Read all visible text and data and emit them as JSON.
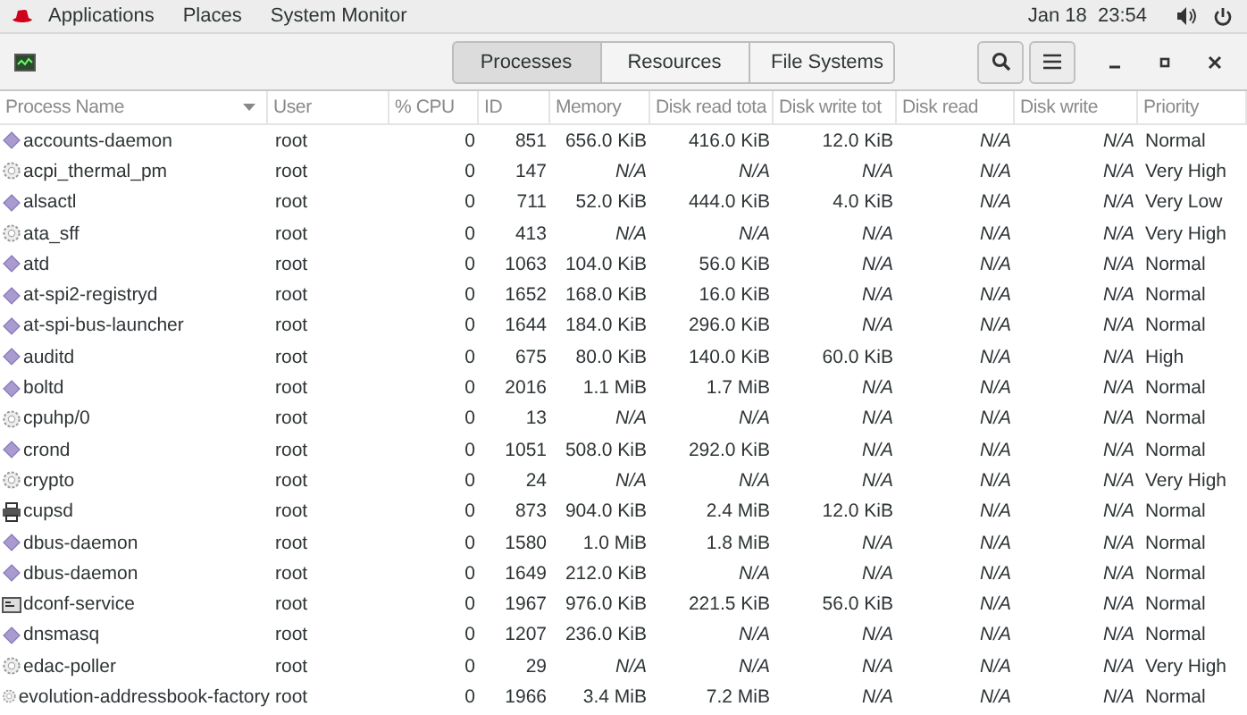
{
  "top_bar": {
    "menus": [
      "Applications",
      "Places",
      "System Monitor"
    ],
    "clock": "Jan 18  23:54"
  },
  "tabs": [
    {
      "label": "Processes",
      "selected": true
    },
    {
      "label": "Resources",
      "selected": false
    },
    {
      "label": "File Systems",
      "selected": false
    }
  ],
  "columns": [
    {
      "label": "Process Name",
      "sorted": true
    },
    {
      "label": "User",
      "sorted": false
    },
    {
      "label": "% CPU",
      "sorted": false
    },
    {
      "label": "ID",
      "sorted": false
    },
    {
      "label": "Memory",
      "sorted": false
    },
    {
      "label": "Disk read tota",
      "sorted": false
    },
    {
      "label": "Disk write tot",
      "sorted": false
    },
    {
      "label": "Disk read",
      "sorted": false
    },
    {
      "label": "Disk write",
      "sorted": false
    },
    {
      "label": "Priority",
      "sorted": false
    }
  ],
  "rows": [
    {
      "kind": "diamond",
      "cells": [
        "accounts-daemon",
        "root",
        "0",
        "851",
        "656.0 KiB",
        "416.0 KiB",
        "12.0 KiB",
        "N/A",
        "N/A",
        "Normal"
      ],
      "italic": [
        false,
        false,
        false,
        false,
        false,
        false,
        false,
        true,
        true,
        false
      ]
    },
    {
      "kind": "gear",
      "cells": [
        "acpi_thermal_pm",
        "root",
        "0",
        "147",
        "N/A",
        "N/A",
        "N/A",
        "N/A",
        "N/A",
        "Very High"
      ],
      "italic": [
        false,
        false,
        false,
        false,
        true,
        true,
        true,
        true,
        true,
        false
      ]
    },
    {
      "kind": "diamond",
      "cells": [
        "alsactl",
        "root",
        "0",
        "711",
        "52.0 KiB",
        "444.0 KiB",
        "4.0 KiB",
        "N/A",
        "N/A",
        "Very Low"
      ],
      "italic": [
        false,
        false,
        false,
        false,
        false,
        false,
        false,
        true,
        true,
        false
      ]
    },
    {
      "kind": "gear",
      "cells": [
        "ata_sff",
        "root",
        "0",
        "413",
        "N/A",
        "N/A",
        "N/A",
        "N/A",
        "N/A",
        "Very High"
      ],
      "italic": [
        false,
        false,
        false,
        false,
        true,
        true,
        true,
        true,
        true,
        false
      ]
    },
    {
      "kind": "diamond",
      "cells": [
        "atd",
        "root",
        "0",
        "1063",
        "104.0 KiB",
        "56.0 KiB",
        "N/A",
        "N/A",
        "N/A",
        "Normal"
      ],
      "italic": [
        false,
        false,
        false,
        false,
        false,
        false,
        true,
        true,
        true,
        false
      ]
    },
    {
      "kind": "diamond",
      "cells": [
        "at-spi2-registryd",
        "root",
        "0",
        "1652",
        "168.0 KiB",
        "16.0 KiB",
        "N/A",
        "N/A",
        "N/A",
        "Normal"
      ],
      "italic": [
        false,
        false,
        false,
        false,
        false,
        false,
        true,
        true,
        true,
        false
      ]
    },
    {
      "kind": "diamond",
      "cells": [
        "at-spi-bus-launcher",
        "root",
        "0",
        "1644",
        "184.0 KiB",
        "296.0 KiB",
        "N/A",
        "N/A",
        "N/A",
        "Normal"
      ],
      "italic": [
        false,
        false,
        false,
        false,
        false,
        false,
        true,
        true,
        true,
        false
      ]
    },
    {
      "kind": "diamond",
      "cells": [
        "auditd",
        "root",
        "0",
        "675",
        "80.0 KiB",
        "140.0 KiB",
        "60.0 KiB",
        "N/A",
        "N/A",
        "High"
      ],
      "italic": [
        false,
        false,
        false,
        false,
        false,
        false,
        false,
        true,
        true,
        false
      ]
    },
    {
      "kind": "diamond",
      "cells": [
        "boltd",
        "root",
        "0",
        "2016",
        "1.1 MiB",
        "1.7 MiB",
        "N/A",
        "N/A",
        "N/A",
        "Normal"
      ],
      "italic": [
        false,
        false,
        false,
        false,
        false,
        false,
        true,
        true,
        true,
        false
      ]
    },
    {
      "kind": "gear",
      "cells": [
        "cpuhp/0",
        "root",
        "0",
        "13",
        "N/A",
        "N/A",
        "N/A",
        "N/A",
        "N/A",
        "Normal"
      ],
      "italic": [
        false,
        false,
        false,
        false,
        true,
        true,
        true,
        true,
        true,
        false
      ]
    },
    {
      "kind": "diamond",
      "cells": [
        "crond",
        "root",
        "0",
        "1051",
        "508.0 KiB",
        "292.0 KiB",
        "N/A",
        "N/A",
        "N/A",
        "Normal"
      ],
      "italic": [
        false,
        false,
        false,
        false,
        false,
        false,
        true,
        true,
        true,
        false
      ]
    },
    {
      "kind": "gear",
      "cells": [
        "crypto",
        "root",
        "0",
        "24",
        "N/A",
        "N/A",
        "N/A",
        "N/A",
        "N/A",
        "Very High"
      ],
      "italic": [
        false,
        false,
        false,
        false,
        true,
        true,
        true,
        true,
        true,
        false
      ]
    },
    {
      "kind": "printer",
      "cells": [
        "cupsd",
        "root",
        "0",
        "873",
        "904.0 KiB",
        "2.4 MiB",
        "12.0 KiB",
        "N/A",
        "N/A",
        "Normal"
      ],
      "italic": [
        false,
        false,
        false,
        false,
        false,
        false,
        false,
        true,
        true,
        false
      ]
    },
    {
      "kind": "diamond",
      "cells": [
        "dbus-daemon",
        "root",
        "0",
        "1580",
        "1.0 MiB",
        "1.8 MiB",
        "N/A",
        "N/A",
        "N/A",
        "Normal"
      ],
      "italic": [
        false,
        false,
        false,
        false,
        false,
        false,
        true,
        true,
        true,
        false
      ]
    },
    {
      "kind": "diamond",
      "cells": [
        "dbus-daemon",
        "root",
        "0",
        "1649",
        "212.0 KiB",
        "N/A",
        "N/A",
        "N/A",
        "N/A",
        "Normal"
      ],
      "italic": [
        false,
        false,
        false,
        false,
        false,
        true,
        true,
        true,
        true,
        false
      ]
    },
    {
      "kind": "terminal",
      "cells": [
        "dconf-service",
        "root",
        "0",
        "1967",
        "976.0 KiB",
        "221.5 KiB",
        "56.0 KiB",
        "N/A",
        "N/A",
        "Normal"
      ],
      "italic": [
        false,
        false,
        false,
        false,
        false,
        false,
        false,
        true,
        true,
        false
      ]
    },
    {
      "kind": "diamond",
      "cells": [
        "dnsmasq",
        "root",
        "0",
        "1207",
        "236.0 KiB",
        "N/A",
        "N/A",
        "N/A",
        "N/A",
        "Normal"
      ],
      "italic": [
        false,
        false,
        false,
        false,
        false,
        true,
        true,
        true,
        true,
        false
      ]
    },
    {
      "kind": "gear",
      "cells": [
        "edac-poller",
        "root",
        "0",
        "29",
        "N/A",
        "N/A",
        "N/A",
        "N/A",
        "N/A",
        "Very High"
      ],
      "italic": [
        false,
        false,
        false,
        false,
        true,
        true,
        true,
        true,
        true,
        false
      ]
    },
    {
      "kind": "gear",
      "cells": [
        "evolution-addressbook-factory",
        "root",
        "0",
        "1966",
        "3.4 MiB",
        "7.2 MiB",
        "N/A",
        "N/A",
        "N/A",
        "Normal"
      ],
      "italic": [
        false,
        false,
        false,
        false,
        false,
        false,
        true,
        true,
        true,
        false
      ]
    }
  ]
}
